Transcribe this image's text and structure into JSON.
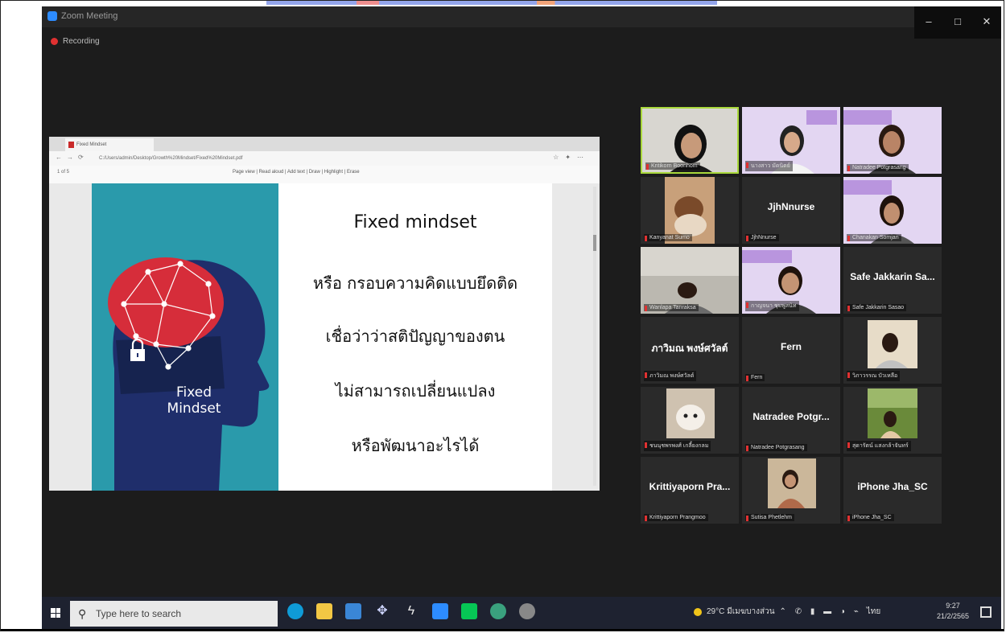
{
  "window": {
    "title": "Zoom Meeting",
    "recording_label": "Recording",
    "controls": [
      "–",
      "□",
      "✕"
    ]
  },
  "shared_screen": {
    "browser_tab": "Fixed Mindset",
    "url": "C:/Users/admin/Desktop/Growth%20Mindset/Fixed%20Mindset.pdf",
    "pdf_page": "1 of 5",
    "pdf_tools": [
      "Page view",
      "Read aloud",
      "Add text",
      "Draw",
      "Highlight",
      "Erase"
    ],
    "slide": {
      "image_label_line1": "Fixed",
      "image_label_line2": "Mindset",
      "heading": "Fixed mindset",
      "line1": "หรือ กรอบความคิดแบบยึดติด",
      "line2": "เชื่อว่าว่าสติปัญญาของตน",
      "line3": "ไม่สามารถเปลี่ยนแปลง",
      "line4": "หรือพัฒนาอะไรได้"
    }
  },
  "participants": [
    {
      "name": "Kritikorn Boonhom",
      "video": true,
      "active": true
    },
    {
      "name": "นางสาว มัดนิตย์",
      "video": true
    },
    {
      "name": "Natradee Potgrasang",
      "video": true
    },
    {
      "name": "Kanyanat Sumo",
      "video": true
    },
    {
      "name": "JjhNnurse",
      "display": "JjhNnurse",
      "video": false
    },
    {
      "name": "Chanakan Somjan",
      "video": true
    },
    {
      "name": "Wanlapa Tanraksa",
      "video": true
    },
    {
      "name": "กาญจนา ชุมพูสนิท",
      "video": true
    },
    {
      "name": "Safe Jakkarin Sasao",
      "display": "Safe Jakkarin Sa...",
      "video": false
    },
    {
      "name": "ภาวิมณ พงษ์ศวัลต์",
      "display": "ภาวิมณ พงษ์ศวัลต์",
      "video": false
    },
    {
      "name": "Fern",
      "display": "Fern",
      "video": false
    },
    {
      "name": "วิภาวรรณ บัวเหลือ",
      "video": true
    },
    {
      "name": "ชนนุชพรพงศ์ เกลี้ยงกลม",
      "video": true
    },
    {
      "name": "Natradee Potgrasang",
      "display": "Natradee Potgr...",
      "video": false
    },
    {
      "name": "สุดารัตน์ แสงกล้าจันทร์",
      "video": true
    },
    {
      "name": "Krittiyaporn Prangmoo",
      "display": "Krittiyaporn Pra...",
      "video": false
    },
    {
      "name": "Sutisa Phetlehm",
      "video": true
    },
    {
      "name": "iPhone Jha_SC",
      "display": "iPhone Jha_SC",
      "video": false
    }
  ],
  "taskbar": {
    "search_placeholder": "Type here to search",
    "weather": "29°C มีเมฆบางส่วน",
    "language": "ไทย",
    "time": "9:27",
    "date": "21/2/2565"
  },
  "colors": {
    "meeting_bg": "#1c1c1c",
    "active_speaker": "#a9d83b",
    "recording": "#e03131",
    "slide_teal": "#2a9aab",
    "slide_navy": "#1f2e6b",
    "brain_red": "#d62d3a"
  }
}
